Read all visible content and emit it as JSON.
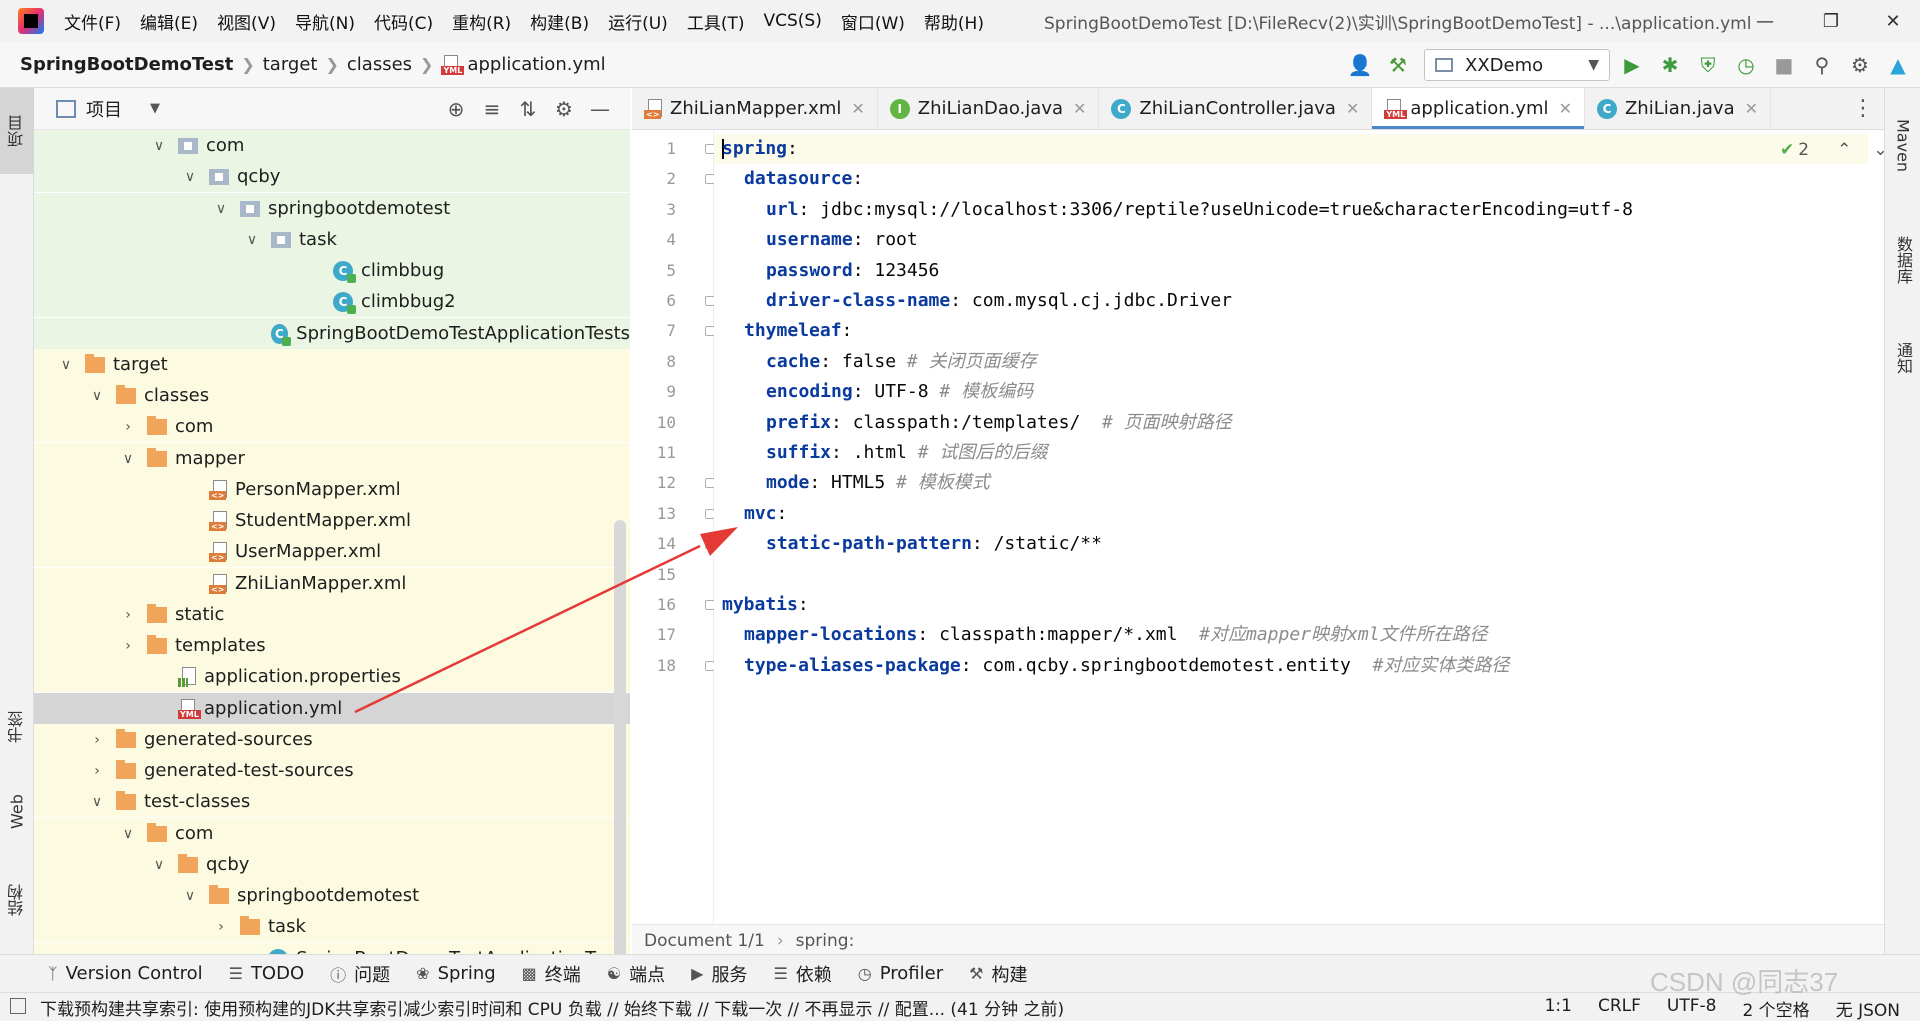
{
  "menubar": {
    "items": [
      "文件(F)",
      "编辑(E)",
      "视图(V)",
      "导航(N)",
      "代码(C)",
      "重构(R)",
      "构建(B)",
      "运行(U)",
      "工具(T)",
      "VCS(S)",
      "窗口(W)",
      "帮助(H)"
    ],
    "window_title": "SpringBootDemoTest [D:\\FileRecv(2)\\实训\\SpringBootDemoTest] - ...\\application.yml"
  },
  "navbar": {
    "project": "SpringBootDemoTest",
    "crumbs": [
      "target",
      "classes",
      "application.yml"
    ],
    "run_config": "XXDemo"
  },
  "left_strip": {
    "project_tab": "项目",
    "bookmarks_tab": "书签",
    "web_tab": "Web",
    "structure_tab": "结构"
  },
  "right_strip": {
    "maven_tab": "Maven",
    "database_tab": "数据库",
    "notifications_tab": "通知"
  },
  "project_panel": {
    "title": "项目",
    "rows": [
      {
        "label": "com",
        "indent": 4,
        "chevron": "v",
        "icon": "folder-gray",
        "bg": "green"
      },
      {
        "label": "qcby",
        "indent": 5,
        "chevron": "v",
        "icon": "folder-gray",
        "bg": "green"
      },
      {
        "label": "springbootdemotest",
        "indent": 6,
        "chevron": "v",
        "icon": "folder-gray",
        "bg": "green"
      },
      {
        "label": "task",
        "indent": 7,
        "chevron": "v",
        "icon": "folder-gray",
        "bg": "green"
      },
      {
        "label": "climbbug",
        "indent": 9,
        "chevron": "",
        "icon": "class-test",
        "bg": "green"
      },
      {
        "label": "climbbug2",
        "indent": 9,
        "chevron": "",
        "icon": "class-test",
        "bg": "green"
      },
      {
        "label": "SpringBootDemoTestApplicationTests",
        "indent": 8,
        "chevron": "",
        "icon": "class-test",
        "bg": "green"
      },
      {
        "label": "target",
        "indent": 1,
        "chevron": "v",
        "icon": "folder-orange",
        "bg": "yellow"
      },
      {
        "label": "classes",
        "indent": 2,
        "chevron": "v",
        "icon": "folder-orange",
        "bg": "yellow"
      },
      {
        "label": "com",
        "indent": 3,
        "chevron": ">",
        "icon": "folder-orange",
        "bg": "yellow"
      },
      {
        "label": "mapper",
        "indent": 3,
        "chevron": "v",
        "icon": "folder-orange",
        "bg": "yellow"
      },
      {
        "label": "PersonMapper.xml",
        "indent": 5,
        "chevron": "",
        "icon": "xml",
        "bg": "yellow"
      },
      {
        "label": "StudentMapper.xml",
        "indent": 5,
        "chevron": "",
        "icon": "xml",
        "bg": "yellow"
      },
      {
        "label": "UserMapper.xml",
        "indent": 5,
        "chevron": "",
        "icon": "xml",
        "bg": "yellow"
      },
      {
        "label": "ZhiLianMapper.xml",
        "indent": 5,
        "chevron": "",
        "icon": "xml",
        "bg": "yellow"
      },
      {
        "label": "static",
        "indent": 3,
        "chevron": ">",
        "icon": "folder-orange",
        "bg": "yellow"
      },
      {
        "label": "templates",
        "indent": 3,
        "chevron": ">",
        "icon": "folder-orange",
        "bg": "yellow"
      },
      {
        "label": "application.properties",
        "indent": 4,
        "chevron": "",
        "icon": "properties",
        "bg": "yellow"
      },
      {
        "label": "application.yml",
        "indent": 4,
        "chevron": "",
        "icon": "yml",
        "bg": "selected"
      },
      {
        "label": "generated-sources",
        "indent": 2,
        "chevron": ">",
        "icon": "folder-orange",
        "bg": "yellow"
      },
      {
        "label": "generated-test-sources",
        "indent": 2,
        "chevron": ">",
        "icon": "folder-orange",
        "bg": "yellow"
      },
      {
        "label": "test-classes",
        "indent": 2,
        "chevron": "v",
        "icon": "folder-orange",
        "bg": "yellow"
      },
      {
        "label": "com",
        "indent": 3,
        "chevron": "v",
        "icon": "folder-orange",
        "bg": "yellow"
      },
      {
        "label": "qcby",
        "indent": 4,
        "chevron": "v",
        "icon": "folder-orange",
        "bg": "yellow"
      },
      {
        "label": "springbootdemotest",
        "indent": 5,
        "chevron": "v",
        "icon": "folder-orange",
        "bg": "yellow"
      },
      {
        "label": "task",
        "indent": 6,
        "chevron": ">",
        "icon": "folder-orange",
        "bg": "yellow"
      },
      {
        "label": "SpringBootDemoTestApplicationTests",
        "indent": 7,
        "chevron": "",
        "icon": "class-test",
        "bg": "yellow"
      }
    ]
  },
  "editor": {
    "tabs": [
      {
        "label": "ZhiLianMapper.xml",
        "icon": "xml",
        "active": false
      },
      {
        "label": "ZhiLianDao.java",
        "icon": "interface",
        "active": false
      },
      {
        "label": "ZhiLianController.java",
        "icon": "class",
        "active": false
      },
      {
        "label": "application.yml",
        "icon": "yml",
        "active": true
      },
      {
        "label": "ZhiLian.java",
        "icon": "class",
        "active": false
      }
    ],
    "inspection_count": "2",
    "lines": [
      {
        "n": "1",
        "indent": 0,
        "key": "spring",
        "rest": ":",
        "comment": ""
      },
      {
        "n": "2",
        "indent": 1,
        "key": "datasource",
        "rest": ":",
        "comment": ""
      },
      {
        "n": "3",
        "indent": 2,
        "key": "url",
        "rest": ": jdbc:mysql://localhost:3306/reptile?useUnicode=true&characterEncoding=utf-8",
        "comment": ""
      },
      {
        "n": "4",
        "indent": 2,
        "key": "username",
        "rest": ": root",
        "comment": ""
      },
      {
        "n": "5",
        "indent": 2,
        "key": "password",
        "rest": ": 123456",
        "comment": ""
      },
      {
        "n": "6",
        "indent": 2,
        "key": "driver-class-name",
        "rest": ": com.mysql.cj.jdbc.Driver",
        "comment": ""
      },
      {
        "n": "7",
        "indent": 1,
        "key": "thymeleaf",
        "rest": ":",
        "comment": ""
      },
      {
        "n": "8",
        "indent": 2,
        "key": "cache",
        "rest": ": false ",
        "comment": "# 关闭页面缓存"
      },
      {
        "n": "9",
        "indent": 2,
        "key": "encoding",
        "rest": ": UTF-8 ",
        "comment": "# 模板编码"
      },
      {
        "n": "10",
        "indent": 2,
        "key": "prefix",
        "rest": ": classpath:/templates/  ",
        "comment": "# 页面映射路径"
      },
      {
        "n": "11",
        "indent": 2,
        "key": "suffix",
        "rest": ": .html ",
        "comment": "# 试图后的后缀"
      },
      {
        "n": "12",
        "indent": 2,
        "key": "mode",
        "rest": ": HTML5 ",
        "comment": "# 模板模式"
      },
      {
        "n": "13",
        "indent": 1,
        "key": "mvc",
        "rest": ":",
        "comment": ""
      },
      {
        "n": "14",
        "indent": 2,
        "key": "static-path-pattern",
        "rest": ": /static/**",
        "comment": ""
      },
      {
        "n": "15",
        "indent": 0,
        "key": "",
        "rest": "",
        "comment": ""
      },
      {
        "n": "16",
        "indent": 0,
        "key": "mybatis",
        "rest": ":",
        "comment": ""
      },
      {
        "n": "17",
        "indent": 1,
        "key": "mapper-locations",
        "rest": ": classpath:mapper/*.xml  ",
        "comment": "#对应mapper映射xml文件所在路径"
      },
      {
        "n": "18",
        "indent": 1,
        "key": "type-aliases-package",
        "rest": ": com.qcby.springbootdemotest.entity  ",
        "comment": "#对应实体类路径"
      }
    ],
    "breadcrumb": {
      "doc": "Document 1/1",
      "path": "spring:"
    }
  },
  "bottom_tools": [
    "Version Control",
    "TODO",
    "问题",
    "Spring",
    "终端",
    "端点",
    "服务",
    "依赖",
    "Profiler",
    "构建"
  ],
  "statusbar": {
    "message": "下载预构建共享索引: 使用预构建的JDK共享索引减少索引时间和 CPU 负载 // 始终下载 // 下载一次 // 不再显示 // 配置... (41 分钟 之前)",
    "position": "1:1",
    "line_sep": "CRLF",
    "encoding": "UTF-8",
    "indent": "2 个空格",
    "schema": "无 JSON"
  },
  "watermark": "CSDN @同志37",
  "colors": {
    "key": "#0a3a9e",
    "comment": "#8c8c8c",
    "green_bg": "#eaf5e4",
    "yellow_bg": "#fcfbe1",
    "selected_bg": "#d5d5d5",
    "arrow": "#e53935"
  }
}
